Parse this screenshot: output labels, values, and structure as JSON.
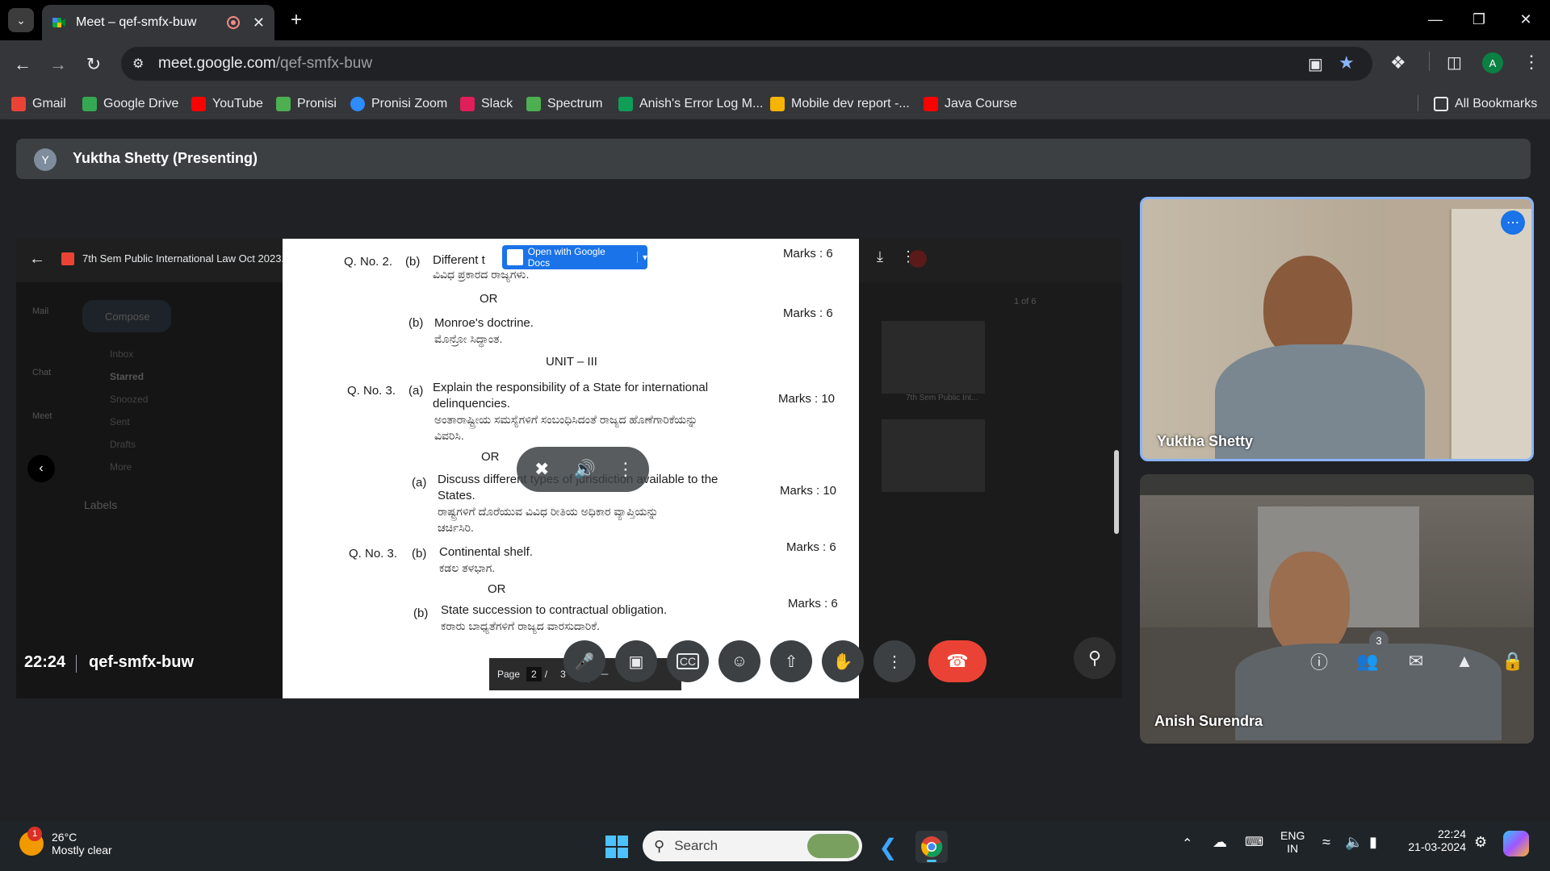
{
  "browser": {
    "tab_title": "Meet – qef-smfx-buw",
    "url_main": "meet.google.com",
    "url_path": "/qef-smfx-buw",
    "profile_initial": "A",
    "bookmarks": [
      {
        "label": "Gmail",
        "color": "#ea4335"
      },
      {
        "label": "Google Drive",
        "color": "#34a853"
      },
      {
        "label": "YouTube",
        "color": "#ff0000"
      },
      {
        "label": "Pronisi",
        "color": "#4caf50"
      },
      {
        "label": "Pronisi Zoom",
        "color": "#2d8cff"
      },
      {
        "label": "Slack",
        "color": "#e01e5a"
      },
      {
        "label": "Spectrum",
        "color": "#4caf50"
      },
      {
        "label": "Anish's Error Log M...",
        "color": "#0f9d58"
      },
      {
        "label": "Mobile dev report -...",
        "color": "#f4b400"
      },
      {
        "label": "Java Course",
        "color": "#ff0000"
      }
    ],
    "all_bookmarks_label": "All Bookmarks"
  },
  "meet": {
    "presenter_initial": "Y",
    "presenter_banner": "Yuktha Shetty (Presenting)",
    "shared_doc_title": "7th Sem Public International Law Oct 2023.pdf",
    "open_with_docs": "Open with Google Docs",
    "pdf_lines": {
      "q2_label": "Q. No. 2.",
      "q2b": "(b)",
      "q2_text": "Different t",
      "q2_kn": "ವಿವಿಧ ಪ್ರಕಾರದ ರಾಜ್ಯಗಳು.",
      "q2_marks": "Marks : 6",
      "or1": "OR",
      "monroe_b": "(b)",
      "monroe": "Monroe's doctrine.",
      "monroe_kn": "ಮೊನ್ರೋ ಸಿದ್ಧಾಂತ.",
      "monroe_marks": "Marks : 6",
      "unit": "UNIT – III",
      "q3_label": "Q. No. 3.",
      "q3a": "(a)",
      "q3_text1": "Explain the responsibility of a State for international",
      "q3_text2": "delinquencies.",
      "q3_kn1": "ಅಂತಾರಾಷ್ಟ್ರೀಯ ಸಮಸ್ಯೆಗಳಿಗೆ ಸಂಬಂಧಿಸಿದಂತೆ ರಾಜ್ಯದ ಹೊಣೆಗಾರಿಕೆಯನ್ನು",
      "q3_kn2": "ವಿವರಿಸಿ.",
      "q3_marks": "Marks : 10",
      "or2": "OR",
      "q3alt_a": "(a)",
      "q3alt_text1": "Discuss different types of jurisdiction available to the",
      "q3alt_text2": "States.",
      "q3alt_kn1": "ರಾಷ್ಟ್ರಗಳಿಗೆ ದೊರೆಯುವ ವಿವಿಧ ರೀತಿಯ ಅಧಿಕಾರ ವ್ಯಾಪ್ತಿಯನ್ನು",
      "q3alt_kn2": "ಚರ್ಚಿಸಿರಿ.",
      "q3alt_marks": "Marks : 10",
      "q3b_label": "Q. No. 3.",
      "q3b": "(b)",
      "q3b_text": "Continental shelf.",
      "q3b_kn": "ಕಡಲ ತಳಭಾಗ.",
      "q3b_marks": "Marks : 6",
      "or3": "OR",
      "q3c_b": "(b)",
      "q3c_text": "State succession to contractual obligation.",
      "q3c_kn": "ಕರಾರು ಬಾಧ್ಯತೆಗಳಿಗೆ ರಾಜ್ಯದ ವಾರಸುದಾರಿಕೆ.",
      "q3c_marks": "Marks : 6"
    },
    "pager": {
      "label": "Page",
      "current": "2",
      "sep": "/",
      "total": "3"
    },
    "gmail_bg": {
      "compose": "Compose",
      "items": [
        "Inbox",
        "Starred",
        "Snoozed",
        "Sent",
        "Drafts",
        "More"
      ],
      "labels": "Labels",
      "rail": [
        "Mail",
        "Chat",
        "Meet"
      ],
      "thumb_label": "7th Sem Public Int...",
      "page_count": "1 of 6"
    },
    "participants": [
      {
        "name": "Yuktha Shetty"
      },
      {
        "name": "Anish Surendra"
      }
    ],
    "time": "22:24",
    "meeting_code": "qef-smfx-buw",
    "people_count": "3"
  },
  "taskbar": {
    "weather_temp": "26°C",
    "weather_desc": "Mostly clear",
    "weather_badge": "1",
    "search_placeholder": "Search",
    "lang1": "ENG",
    "lang2": "IN",
    "time": "22:24",
    "date": "21-03-2024"
  }
}
